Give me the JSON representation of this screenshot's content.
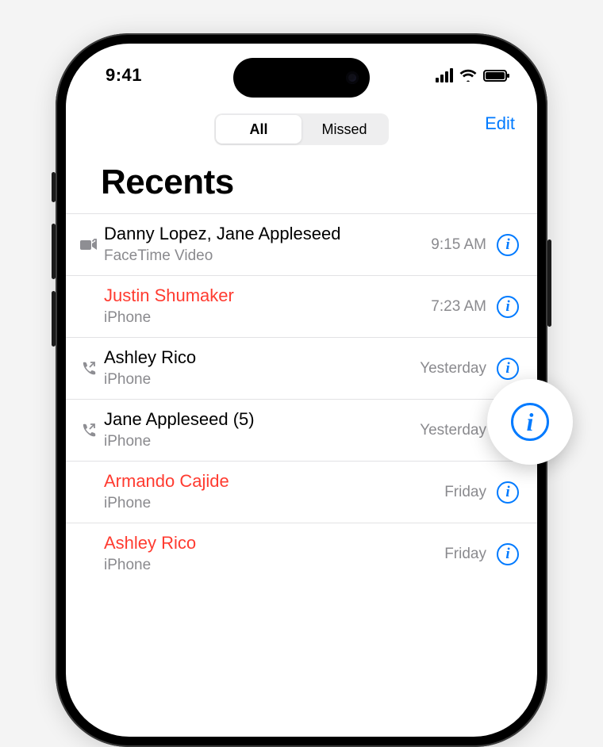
{
  "status": {
    "time": "9:41"
  },
  "header": {
    "segmented": {
      "all": "All",
      "missed": "Missed",
      "active": "all"
    },
    "edit": "Edit"
  },
  "title": "Recents",
  "colors": {
    "accent": "#007aff",
    "missed": "#ff3b30"
  },
  "calls": [
    {
      "name": "Danny Lopez, Jane Appleseed",
      "sub": "FaceTime Video",
      "time": "9:15 AM",
      "missed": false,
      "icon": "video-out"
    },
    {
      "name": "Justin Shumaker",
      "sub": "iPhone",
      "time": "7:23 AM",
      "missed": true,
      "icon": "none"
    },
    {
      "name": "Ashley Rico",
      "sub": "iPhone",
      "time": "Yesterday",
      "missed": false,
      "icon": "phone-out"
    },
    {
      "name": "Jane Appleseed (5)",
      "sub": "iPhone",
      "time": "Yesterday",
      "missed": false,
      "icon": "phone-out"
    },
    {
      "name": "Armando Cajide",
      "sub": "iPhone",
      "time": "Friday",
      "missed": true,
      "icon": "none"
    },
    {
      "name": "Ashley Rico",
      "sub": "iPhone",
      "time": "Friday",
      "missed": true,
      "icon": "none"
    }
  ]
}
